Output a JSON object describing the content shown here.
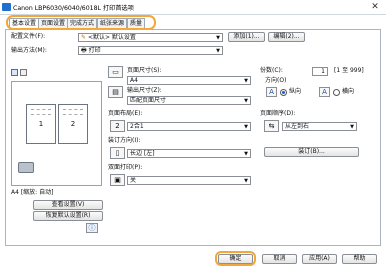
{
  "window": {
    "title": "Canon LBP6030/6040/6018L 打印首选项"
  },
  "tabs": [
    "基本设置",
    "页面设置",
    "完成方式",
    "纸张来源",
    "质量"
  ],
  "profile": {
    "label": "配置文件(F):",
    "value": "<默认> 默认设置",
    "add": "添加(1)...",
    "edit": "编辑(2)..."
  },
  "output": {
    "label": "输出方法(M):",
    "value": "打印"
  },
  "preview": {
    "caption": "A4 [缩放: 自动]",
    "view_settings": "查看设置(V)",
    "restore_default": "恢复默认设置(R)",
    "page_left": "1",
    "page_right": "2"
  },
  "page_size": {
    "label": "页面尺寸(S):",
    "value": "A4"
  },
  "output_size": {
    "label": "输出尺寸(Z):",
    "value": "匹配页面尺寸"
  },
  "copies": {
    "label": "份数(C):",
    "value": "1",
    "range": "[1 至 999]"
  },
  "orientation": {
    "label": "方向(O)",
    "portrait": "纵向",
    "landscape": "横向",
    "portrait_glyph": "A",
    "landscape_glyph": "A"
  },
  "layout": {
    "label": "页面布局(E):",
    "value": "2合1"
  },
  "page_order": {
    "label": "页面顺序(D):",
    "value": "从左到右"
  },
  "binding": {
    "label": "装订方向(I):",
    "value": "长边 [左]",
    "button": "装订(B)..."
  },
  "duplex": {
    "label": "双面打印(P):",
    "value": "关"
  },
  "footer": {
    "ok": "确定",
    "cancel": "取消",
    "apply": "应用(A)",
    "help": "帮助"
  }
}
